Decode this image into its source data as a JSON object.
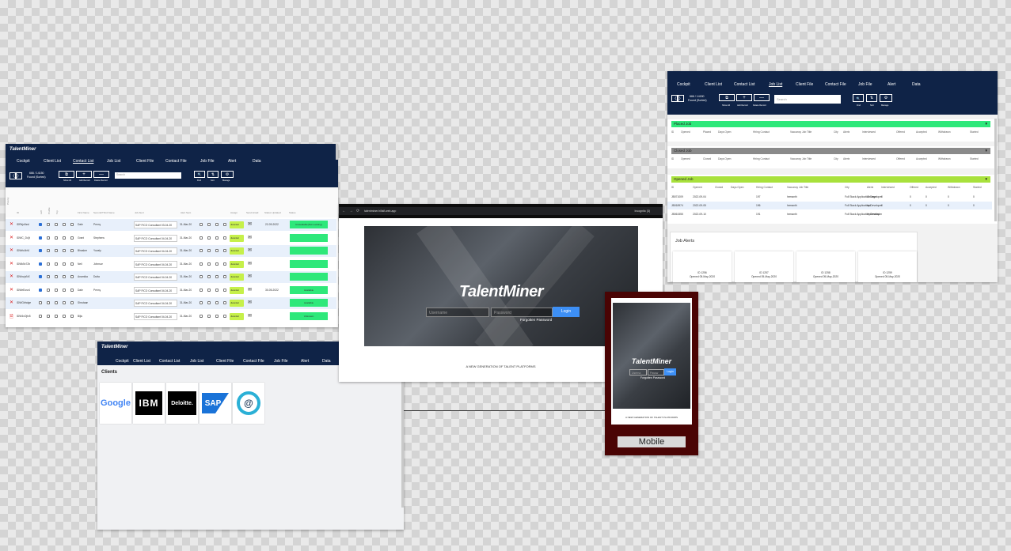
{
  "app_name": "TalentMiner",
  "colors": {
    "navy": "#0f2347",
    "green": "#2ee87a",
    "lime": "#c6f04a",
    "gray_bar": "#8a8a8a",
    "lime_bar": "#a8e13c",
    "login_blue": "#3d8ff5",
    "mobile_frame": "#4a0404"
  },
  "nav": {
    "cockpit": "Cockpit",
    "client_list": "Client List",
    "contact_list": "Contact List",
    "job_list": "Job List",
    "client_file": "Client File",
    "contact_file": "Contact File",
    "job_file": "Job File",
    "alert": "Alert",
    "data": "Data"
  },
  "toolbar": {
    "record_count": "666 / 14150",
    "found": "Found (Sorted)",
    "show_all": "Show All",
    "add_record": "Add Record",
    "delete_record": "Delete Record",
    "search_placeholder": "Search",
    "find": "Find",
    "sort": "Sort",
    "manage": "Manage",
    "btn_show_all": "⧉",
    "btn_add": "+",
    "btn_delete": "—",
    "btn_find": "🔍",
    "btn_sort": "⇅",
    "btn_manage": "⚙",
    "prev": "〈",
    "next": "〉"
  },
  "contacts": {
    "columns": [
      "Priority",
      "ID",
      "Left",
      "Profile",
      "Top",
      "First Name",
      "Second/Third Name",
      "Job Alert",
      "Alert Sent",
      "Assign",
      "Send Email",
      "Status Updated",
      "Status"
    ],
    "rows": [
      {
        "mark": "✕",
        "id": "IDRkjo5zsl",
        "first": "Dale",
        "last": "Penny",
        "job": "SAP FICO Consultant 03-04-20",
        "alert": "31-Mar-20",
        "assign": "Jiwanlal",
        "updated": "22-09-2022",
        "status": "Unavailable(Not Looking)",
        "checked": true
      },
      {
        "mark": "✕",
        "id": "IDWC_Dc]b",
        "first": "Grant",
        "last": "Stephens",
        "job": "SAP FICO Consultant 04-04-20",
        "alert": "31-Mar-20",
        "assign": "Jiwanlal",
        "updated": "",
        "status": "",
        "checked": true
      },
      {
        "mark": "✕",
        "id": "IDWrk4bh1",
        "first": "Bhasker",
        "last": "Yuvaly",
        "job": "SAP FICO Consultant 04-04-20",
        "alert": "31-Mar-20",
        "assign": "Jiwanlal",
        "updated": "",
        "status": "",
        "checked": true
      },
      {
        "mark": "✕",
        "id": "IDWk5x72b",
        "first": "Neil",
        "last": "Johnson",
        "job": "SAP FICO Consultant 04-04-20",
        "alert": "31-Mar-20",
        "assign": "Jiwanlal",
        "updated": "",
        "status": "",
        "checked": true
      },
      {
        "mark": "✕",
        "id": "IDWxzjxNX",
        "first": "Anamika",
        "last": "Dutta",
        "job": "SAP FICO Consultant 04-04-20",
        "alert": "31-Mar-20",
        "assign": "Jiwanlal",
        "updated": "",
        "status": "",
        "checked": true
      },
      {
        "mark": "✕",
        "id": "IDWeEosr4",
        "first": "Dale",
        "last": "Penny",
        "job": "SAP FICO Consultant 04-04-20",
        "alert": "31-Mar-20",
        "assign": "Jiwanlal",
        "updated": "30-05-2022",
        "status": "Available",
        "checked": true
      },
      {
        "mark": "✕",
        "id": "IDWGbhdge",
        "first": "Shrutaan",
        "last": "",
        "job": "SAP FICO Consultant 04-04-20",
        "alert": "31-Mar-20",
        "assign": "Jiwanlal",
        "updated": "",
        "status": "Available",
        "checked": false
      },
      {
        "mark": "🗎",
        "id": "IDW4xOjtv5",
        "first": "Bijiu",
        "last": "",
        "job": "SAP FICO Consultant 04-04-20",
        "alert": "31-Mar-20",
        "assign": "Jiwanlal",
        "updated": "",
        "status": "Unknown",
        "checked": false
      }
    ]
  },
  "clients": {
    "title": "Clients",
    "logos": [
      {
        "name": "Google",
        "color": "#4285f4"
      },
      {
        "name": "IBM",
        "color": "#ffffff"
      },
      {
        "name": "Deloitte.",
        "color": "#ffffff"
      },
      {
        "name": "SAP",
        "color": "#ffffff"
      },
      {
        "name": "@",
        "color": "#2bb0d6"
      }
    ]
  },
  "browser": {
    "url": "talentminer.hillsfi.web.app",
    "incognito": "Incognito (3)"
  },
  "login": {
    "brand": "TalentMiner",
    "username_ph": "Username",
    "password_ph": "Password",
    "login": "Login",
    "forgot": "Forgotten Password",
    "tagline": "A NEW GENERATION OF TALENT PLATFORMS"
  },
  "mobile": {
    "label": "Mobile",
    "username_ph": "Userna",
    "password_ph": "Passw",
    "login": "Login",
    "forgot": "Forgotten Password"
  },
  "jobs": {
    "placed_title": "Placed Job",
    "closed_title": "Closed Job",
    "opened_title": "Opened Job",
    "placed_cols": [
      "ID",
      "Opened",
      "Placed",
      "Days Open",
      "Hiring Contact",
      "Vaccancy Job Title",
      "City",
      "Alerts",
      "Interviewed",
      "Offered",
      "Accepted",
      "Withdrawn",
      "Started"
    ],
    "closed_cols": [
      "ID",
      "Opened",
      "Closed",
      "Days Open",
      "Hiring Contact",
      "Vaccancy Job Title",
      "City",
      "Alerts",
      "Interviewed",
      "Offered",
      "Accepted",
      "Withdrawn",
      "Started"
    ],
    "opened_cols": [
      "ID",
      "Opened",
      "Closed",
      "Days Open",
      "Hiring Contact",
      "Vaccancy Job Title",
      "City",
      "Alerts",
      "Interviewed",
      "Offered",
      "Accepted",
      "Withdrawn",
      "Started"
    ],
    "opened_rows": [
      [
        "JB071009",
        "2022-09-04",
        "",
        "197",
        "hemanth",
        "Full Stack Application Developer",
        "Chicago",
        "0",
        "0",
        "0",
        "0",
        "0"
      ],
      [
        "JB018974",
        "2022-09-05",
        "",
        "196",
        "hemanth",
        "Full Stack Application Developer",
        "hyd",
        "0",
        "0",
        "0",
        "0",
        "0"
      ],
      [
        "JB061555",
        "2022-09-10",
        "",
        "191",
        "hemanth",
        "Full Stack Application Developer",
        "Hyderabad",
        "",
        "",
        "",
        "",
        ""
      ]
    ],
    "alerts_title": "Job Alerts",
    "alert_cards": [
      {
        "id": "ID 1256",
        "opened": "Opened 05-May-2020"
      },
      {
        "id": "ID 1257",
        "opened": "Opened 05-May-2020"
      },
      {
        "id": "ID 1258",
        "opened": "Opened 05-May-2020"
      },
      {
        "id": "ID 1259",
        "opened": "Opened 05-May-2020"
      }
    ]
  }
}
